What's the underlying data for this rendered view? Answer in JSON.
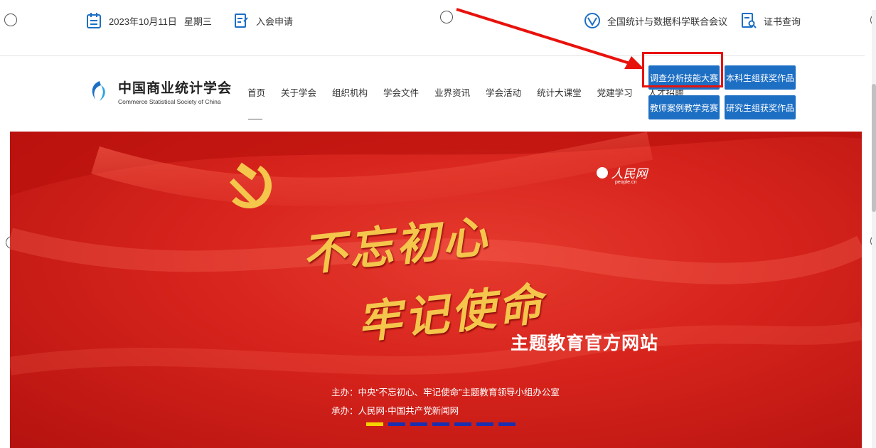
{
  "topbar": {
    "date": "2023年10月11日",
    "weekday": "星期三",
    "join_label": "入会申请",
    "conference_label": "全国统计与数据科学联合会议",
    "certificate_label": "证书查询"
  },
  "logo": {
    "name_cn": "中国商业统计学会",
    "name_en": "Commerce Statistical Society of China"
  },
  "nav": {
    "items": [
      "首页",
      "关于学会",
      "组织机构",
      "学会文件",
      "业界资讯",
      "学会活动",
      "统计大课堂",
      "党建学习",
      "人才招聘"
    ]
  },
  "buttons": {
    "survey_contest": "调查分析技能大赛",
    "undergrad_awards": "本科生组获奖作品",
    "teaching_case": "教师案例教学竞赛",
    "grad_awards": "研究生组获奖作品"
  },
  "banner": {
    "calligraphy_line1": "不忘初心",
    "calligraphy_line2": "牢记使命",
    "subtitle": "主题教育官方网站",
    "host_line": "主办：中央“不忘初心、牢记使命”主题教育领导小组办公室",
    "organizer_line": "承办：人民网·中国共产党新闻网",
    "people_logo_text": "人民网",
    "people_logo_sub": "people.cn",
    "carousel_dots": 7,
    "active_dot": 0
  },
  "colors": {
    "brand_blue": "#1d6fc4",
    "banner_red": "#d6231c",
    "annotation_red": "#e8120c",
    "gold": "#f4c64c",
    "dot_active": "#f5d400",
    "dot_inactive": "#1a2fb0"
  }
}
